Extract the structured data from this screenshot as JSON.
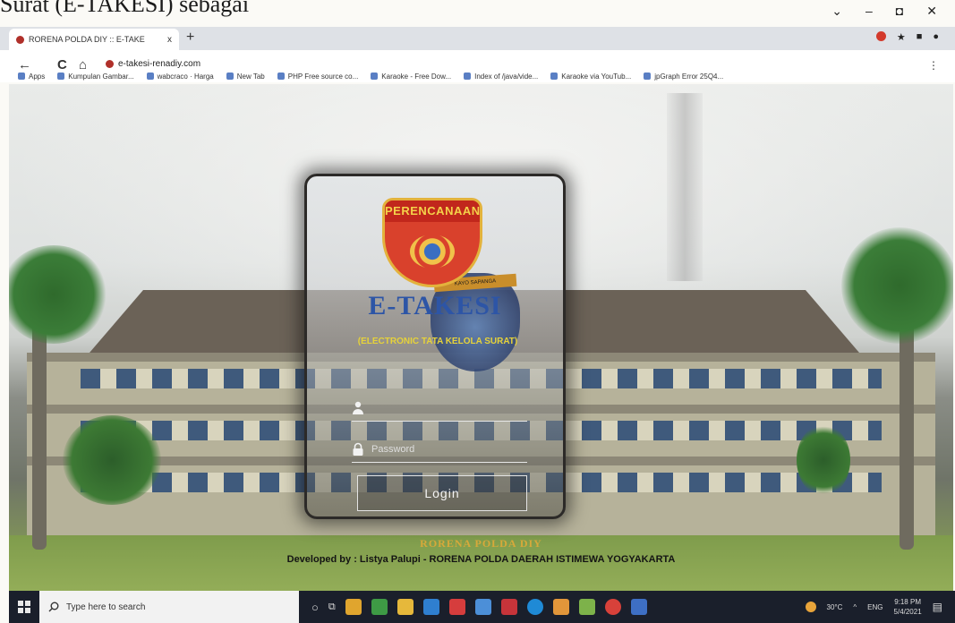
{
  "document": {
    "caption": "Surat (E-TAKESI) sebagai"
  },
  "window": {
    "controls": [
      "⌄",
      "–",
      "◘",
      "✕"
    ]
  },
  "browser": {
    "tab_title": "RORENA POLDA DIY :: E-TAKE",
    "tab_close": "x",
    "new_tab": "+",
    "url": "e-takesi-renadiy.com",
    "nav": {
      "back": "←",
      "forward": "→",
      "reload": "C",
      "home": "⌂"
    },
    "bookmarks": [
      "Apps",
      "Kumpulan Gambar...",
      "wabcraco · Harga",
      "New Tab",
      "PHP Free source co...",
      "Karaoke - Free Dow...",
      "Index of /java/vide...",
      "Karaoke via YouTub...",
      "jpGraph Error 25Q4..."
    ]
  },
  "login": {
    "shield_banner": "PERENCANAAN",
    "back_badge_text": "KAYO SAPANGA",
    "app_title": "E-TAKESI",
    "tagline": "(ELECTRONIC TATA KELOLA SURAT)",
    "username_placeholder": "",
    "password_placeholder": "Password",
    "login_label": "Login"
  },
  "footer": {
    "org": "RORENA POLDA DIY",
    "credit": "Developed by : Listya Palupi - RORENA POLDA DAERAH ISTIMEWA YOGYAKARTA"
  },
  "taskbar": {
    "search_placeholder": "Type here to search",
    "temperature": "30°C",
    "language": "ENG",
    "time": "9:18 PM",
    "date": "5/4/2021"
  },
  "colors": {
    "brand_blue": "#2d55a6",
    "tagline_yellow": "#e6d23a",
    "org_gold": "#d7a93a",
    "shield_red": "#d9412c"
  }
}
